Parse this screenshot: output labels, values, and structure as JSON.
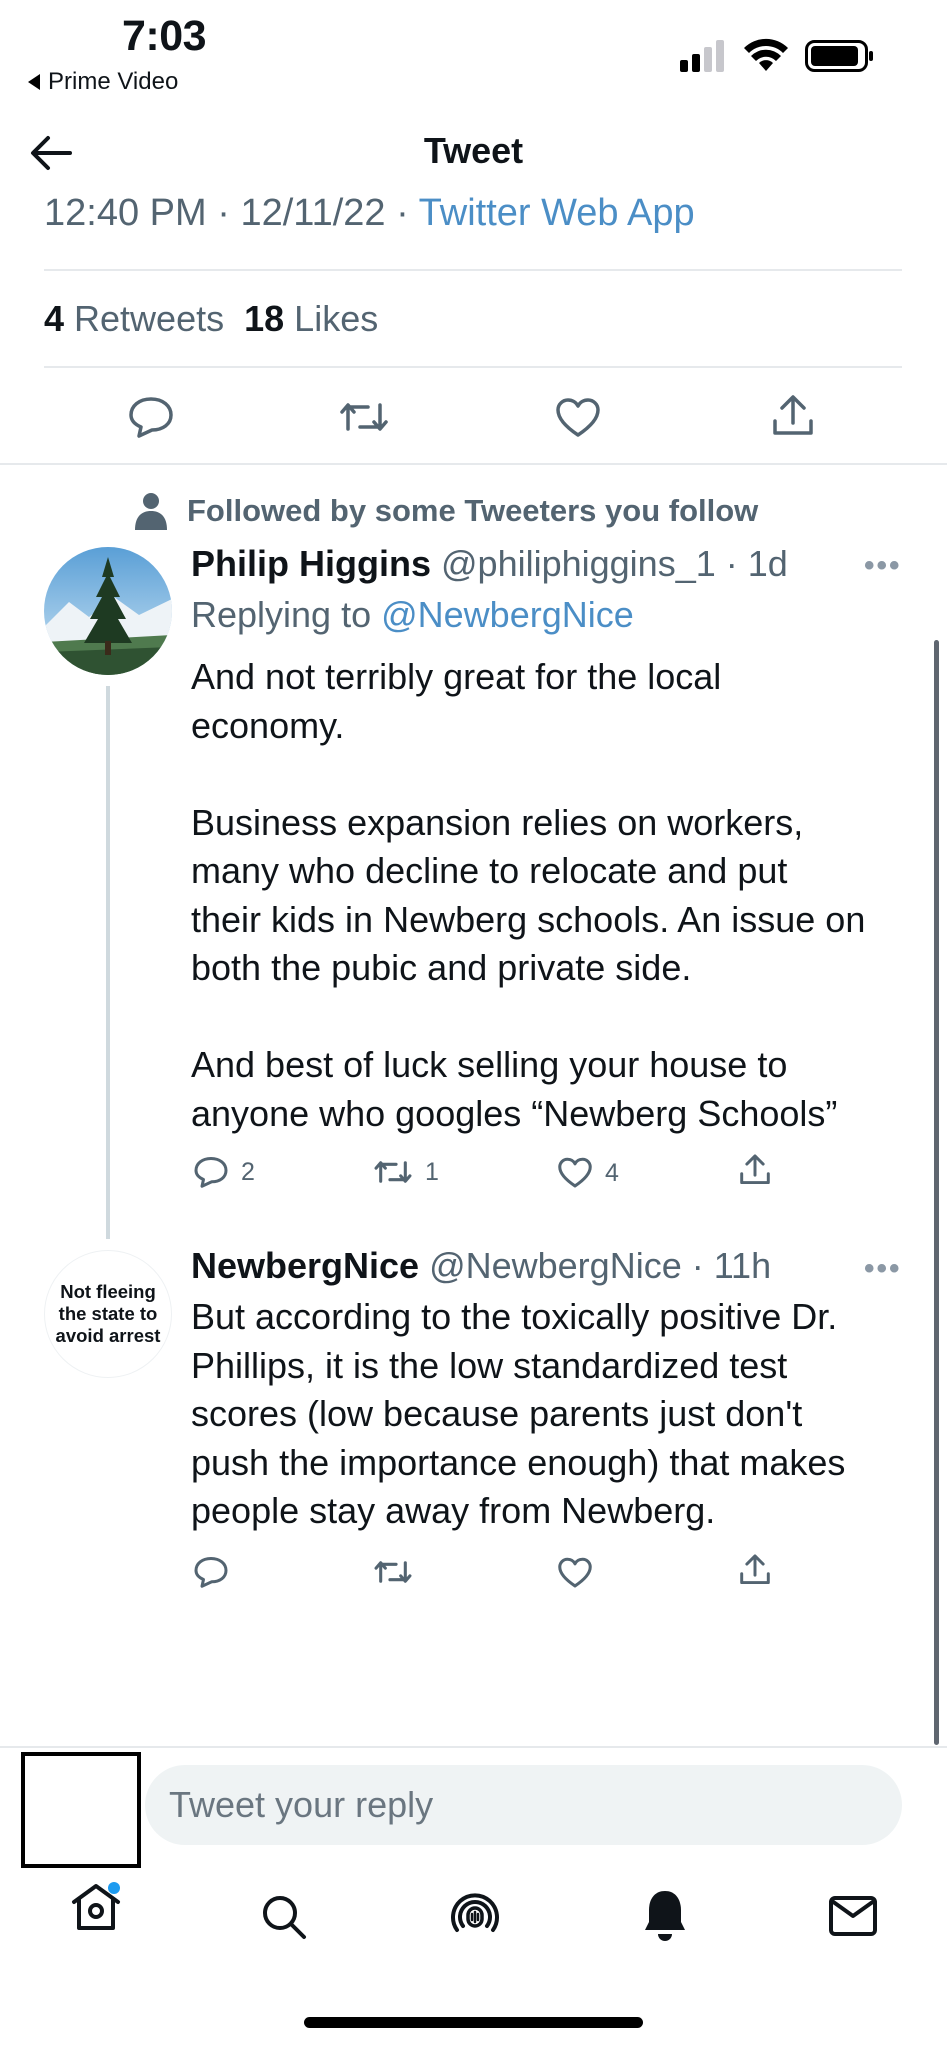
{
  "status_bar": {
    "time": "7:03",
    "back_app": "Prime Video"
  },
  "header": {
    "title": "Tweet"
  },
  "tweet_meta": {
    "time": "12:40 PM",
    "sep1": " · ",
    "date": "12/11/22",
    "sep2": " · ",
    "source": "Twitter Web App"
  },
  "tweet_stats": {
    "retweets_count": "4",
    "retweets_label": " Retweets",
    "likes_count": "18",
    "likes_label": " Likes"
  },
  "context": {
    "followed_by": "Followed by some Tweeters you follow"
  },
  "replies": [
    {
      "name": "Philip Higgins",
      "handle": " @philiphiggins_1",
      "age": " · 1d",
      "replying_prefix": "Replying to ",
      "replying_to": "@NewbergNice",
      "lines": [
        "And not terribly great for the local",
        "economy.",
        "",
        "Business expansion relies on workers,",
        "many who decline to relocate and put",
        "their kids in Newberg schools. An issue on",
        "both the pubic and private side.",
        "",
        "And best of luck selling your house to",
        "anyone who googles “Newberg Schools”"
      ],
      "reply_count": "2",
      "retweet_count": "1",
      "like_count": "4"
    },
    {
      "name": "NewbergNice",
      "handle": " @NewbergNice",
      "age": " · 11h",
      "avatar_lines": [
        "Not fleeing",
        "the state to",
        "avoid arrest"
      ],
      "lines": [
        "But according to the toxically positive Dr.",
        "Phillips, it is the low standardized test",
        "scores (low because parents just don't",
        "push the importance enough) that makes",
        "people stay away from Newberg."
      ]
    }
  ],
  "reply_box": {
    "placeholder": "Tweet your reply"
  },
  "more_glyph": "•••",
  "icons": [
    "back-arrow-icon",
    "comment-icon",
    "retweet-icon",
    "heart-icon",
    "share-icon",
    "home-icon",
    "search-icon",
    "spaces-icon",
    "bell-icon",
    "mail-icon",
    "person-icon",
    "tree-avatar-icon"
  ],
  "colors": {
    "link": "#4b8ec6",
    "muted": "#536471",
    "notification_dot": "#1d9bf0"
  }
}
